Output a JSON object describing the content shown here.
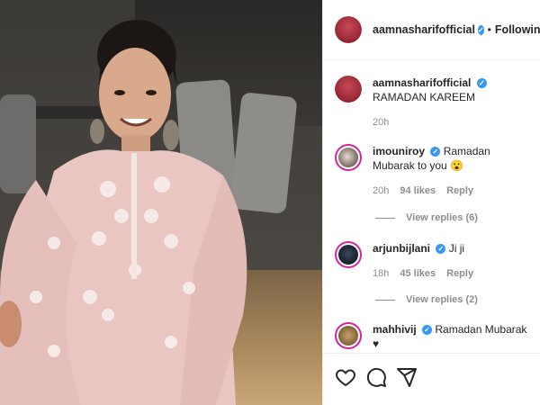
{
  "post": {
    "username": "aamnasharifofficial",
    "follow_status": "Following",
    "separator": "•"
  },
  "caption": {
    "username": "aamnasharifofficial",
    "text": "RAMADAN KAREEM",
    "time": "20h"
  },
  "comments": [
    {
      "username": "imouniroy",
      "text": "Ramadan Mubarak to you 😮",
      "time": "20h",
      "likes": "94 likes",
      "reply": "Reply",
      "view_replies": "View replies (6)"
    },
    {
      "username": "arjunbijlani",
      "text": "Ji ji",
      "time": "18h",
      "likes": "45 likes",
      "reply": "Reply",
      "view_replies": "View replies (2)"
    },
    {
      "username": "mahhivij",
      "text": "Ramadan Mubarak ♥"
    }
  ],
  "icons": {
    "like": "heart-icon",
    "comment": "comment-icon",
    "share": "share-icon",
    "verified": "verified-badge-icon"
  },
  "colors": {
    "verified": "#3897f0",
    "story_ring": "#d6249f",
    "muted": "#8e8e8e"
  }
}
